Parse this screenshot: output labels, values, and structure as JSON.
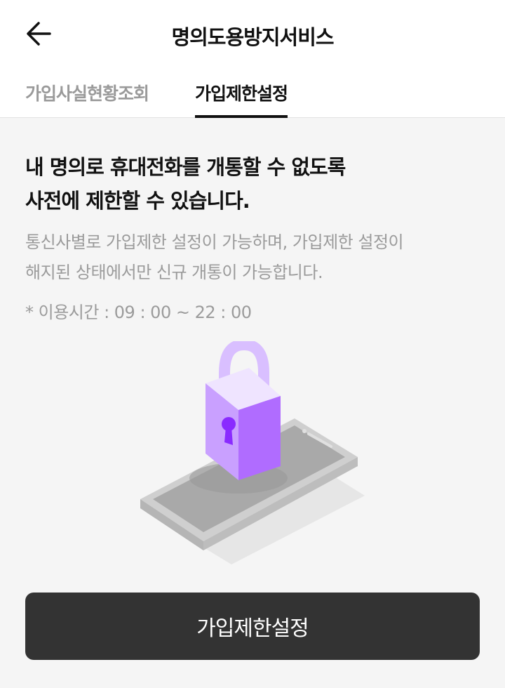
{
  "header": {
    "title": "명의도용방지서비스",
    "back_icon": "arrow-left-icon"
  },
  "tabs": [
    {
      "label": "가입사실현황조회",
      "active": false
    },
    {
      "label": "가입제한설정",
      "active": true
    }
  ],
  "main": {
    "headline_line1": "내 명의로 휴대전화를 개통할 수 없도록",
    "headline_line2": "사전에 제한할 수 있습니다.",
    "description_line1": "통신사별로 가입제한 설정이 가능하며, 가입제한 설정이",
    "description_line2": "해지된 상태에서만 신규 개통이 가능합니다.",
    "hours": "* 이용시간 : 09 : 00 ~ 22 : 00",
    "illustration_icon": "lock-on-phone-icon"
  },
  "cta": {
    "label": "가입제한설정"
  },
  "colors": {
    "cta_background": "#333333",
    "lock_purple": "#c9a0ff",
    "lock_body_light": "#dcc3ff",
    "keyhole": "#9b3cff"
  }
}
